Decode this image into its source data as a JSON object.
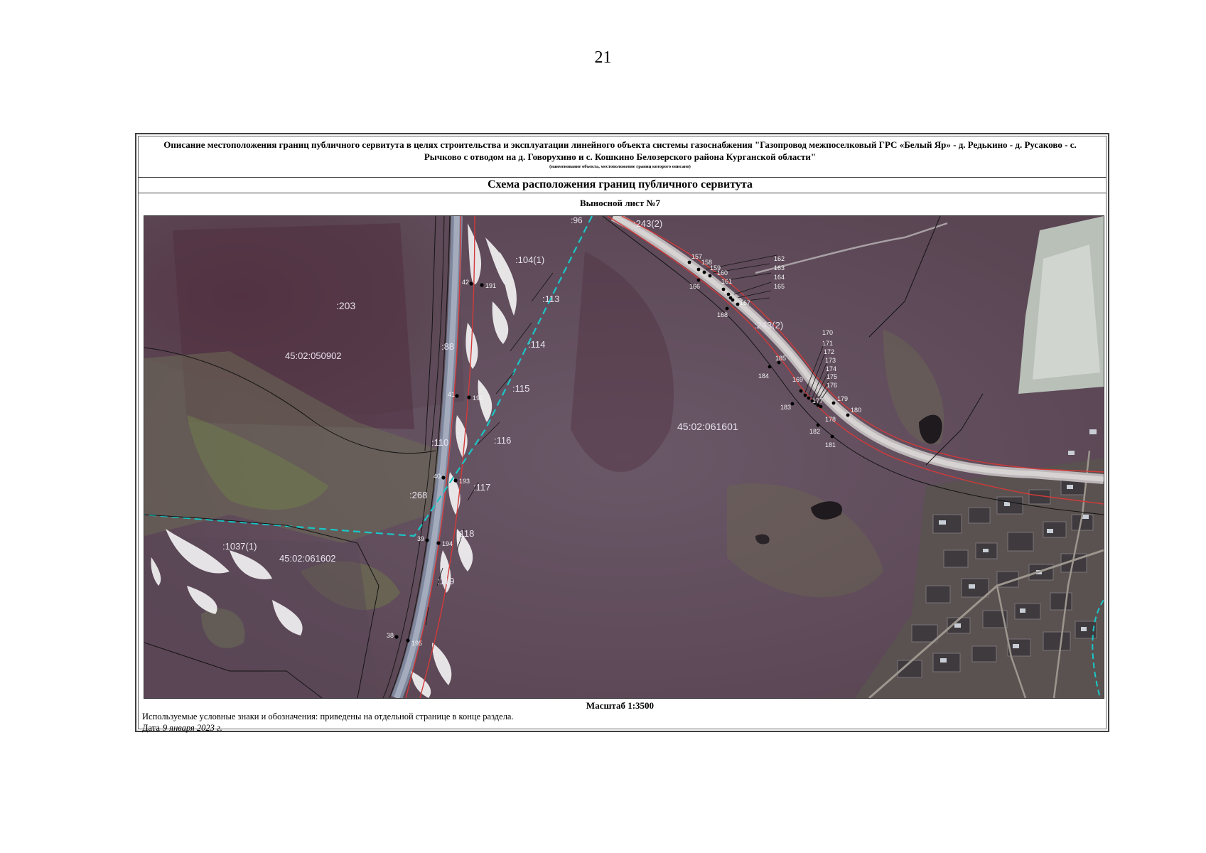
{
  "page_number": "21",
  "header": {
    "title": "Описание местоположения границ публичного сервитута в целях строительства и эксплуатации линейного объекта системы газоснабжения \"Газопровод межпоселковый ГРС «Белый Яр» - д. Редькино - д. Русаково - с. Рычково с отводом на д. Говорухино и с. Кошкино Белозерского района Курганской области\"",
    "note": "(наименование объекта, местоположение границ которого описано)"
  },
  "scheme_title": "Схема расположения границ публичного сервитута",
  "sheet_title": "Выносной лист №7",
  "map": {
    "cadastral_labels": [
      ":203",
      "45:02:050902",
      ":104(1)",
      ":113",
      ":114",
      ":115",
      ":116",
      ":117",
      ":118",
      ":119",
      ":88",
      ":110",
      ":268",
      ":1037(1)",
      "45:02:061602",
      "45:02:061601",
      ":243(2)",
      ":243(2)",
      ":96"
    ],
    "points_road": [
      "42",
      "191",
      "41",
      "192",
      "40",
      "193",
      "39",
      "194",
      "38",
      "195"
    ],
    "points_pipe_upper": [
      "157",
      "158",
      "159",
      "160",
      "161",
      "162",
      "163",
      "164",
      "165",
      "166",
      "167",
      "168"
    ],
    "points_pipe_lower": [
      "169",
      "170",
      "171",
      "172",
      "173",
      "174",
      "175",
      "176",
      "177",
      "178",
      "179",
      "180",
      "181",
      "182",
      "183",
      "184",
      "185"
    ],
    "colors": {
      "boundary_red": "#d23a3a",
      "cadastral_dashed": "#19c7c7",
      "parcel_black": "#141414",
      "road": "#8d94a8"
    }
  },
  "scale": "Масштаб 1:3500",
  "legend_text": "Используемые условные знаки и обозначения: приведены на отдельной странице в конце раздела.",
  "date": {
    "label": "Дата",
    "value": "9 января 2023 г."
  }
}
